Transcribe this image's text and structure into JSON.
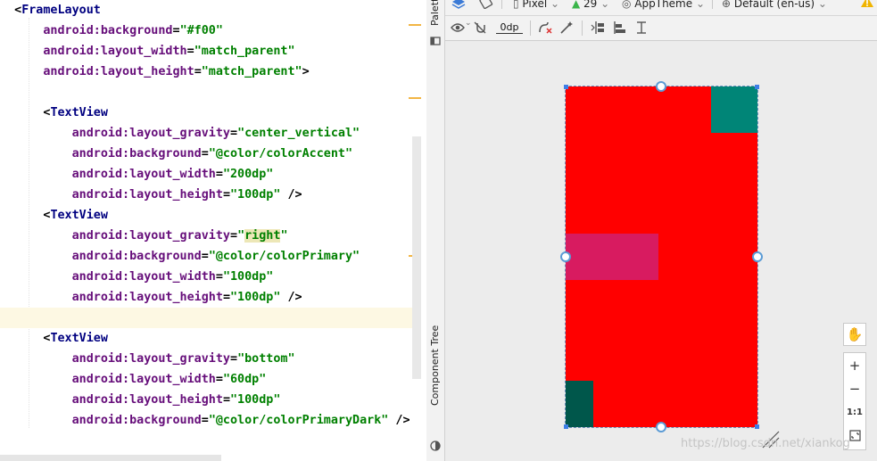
{
  "editor": {
    "lines": [
      {
        "parts": [
          {
            "c": "plain",
            "t": "  <"
          },
          {
            "c": "tag",
            "t": "FrameLayout"
          }
        ]
      },
      {
        "parts": [
          {
            "c": "plain",
            "t": "      "
          },
          {
            "c": "attr",
            "t": "android:background"
          },
          {
            "c": "plain",
            "t": "="
          },
          {
            "c": "val",
            "t": "\"#f00\""
          }
        ]
      },
      {
        "parts": [
          {
            "c": "plain",
            "t": "      "
          },
          {
            "c": "attr",
            "t": "android:layout_width"
          },
          {
            "c": "plain",
            "t": "="
          },
          {
            "c": "val",
            "t": "\"match_parent\""
          }
        ]
      },
      {
        "parts": [
          {
            "c": "plain",
            "t": "      "
          },
          {
            "c": "attr",
            "t": "android:layout_height"
          },
          {
            "c": "plain",
            "t": "="
          },
          {
            "c": "val",
            "t": "\"match_parent\""
          },
          {
            "c": "plain",
            "t": ">"
          }
        ]
      },
      {
        "parts": []
      },
      {
        "parts": [
          {
            "c": "plain",
            "t": "      <"
          },
          {
            "c": "tag",
            "t": "TextView"
          }
        ]
      },
      {
        "parts": [
          {
            "c": "plain",
            "t": "          "
          },
          {
            "c": "attr",
            "t": "android:layout_gravity"
          },
          {
            "c": "plain",
            "t": "="
          },
          {
            "c": "val",
            "t": "\"center_vertical\""
          }
        ]
      },
      {
        "parts": [
          {
            "c": "plain",
            "t": "          "
          },
          {
            "c": "attr",
            "t": "android:background"
          },
          {
            "c": "plain",
            "t": "="
          },
          {
            "c": "val",
            "t": "\"@color/colorAccent\""
          }
        ]
      },
      {
        "parts": [
          {
            "c": "plain",
            "t": "          "
          },
          {
            "c": "attr",
            "t": "android:layout_width"
          },
          {
            "c": "plain",
            "t": "="
          },
          {
            "c": "val",
            "t": "\"200dp\""
          }
        ]
      },
      {
        "parts": [
          {
            "c": "plain",
            "t": "          "
          },
          {
            "c": "attr",
            "t": "android:layout_height"
          },
          {
            "c": "plain",
            "t": "="
          },
          {
            "c": "val",
            "t": "\"100dp\""
          },
          {
            "c": "plain",
            "t": " />"
          }
        ]
      },
      {
        "parts": [
          {
            "c": "plain",
            "t": "      <"
          },
          {
            "c": "tag",
            "t": "TextView"
          }
        ]
      },
      {
        "parts": [
          {
            "c": "plain",
            "t": "          "
          },
          {
            "c": "attr",
            "t": "android:layout_gravity"
          },
          {
            "c": "plain",
            "t": "="
          },
          {
            "c": "val",
            "t": "\""
          },
          {
            "c": "valhl",
            "t": "right"
          },
          {
            "c": "val",
            "t": "\""
          }
        ]
      },
      {
        "parts": [
          {
            "c": "plain",
            "t": "          "
          },
          {
            "c": "attr",
            "t": "android:background"
          },
          {
            "c": "plain",
            "t": "="
          },
          {
            "c": "val",
            "t": "\"@color/colorPrimary\""
          }
        ]
      },
      {
        "parts": [
          {
            "c": "plain",
            "t": "          "
          },
          {
            "c": "attr",
            "t": "android:layout_width"
          },
          {
            "c": "plain",
            "t": "="
          },
          {
            "c": "val",
            "t": "\"100dp\""
          }
        ]
      },
      {
        "parts": [
          {
            "c": "plain",
            "t": "          "
          },
          {
            "c": "attr",
            "t": "android:layout_height"
          },
          {
            "c": "plain",
            "t": "="
          },
          {
            "c": "val",
            "t": "\"100dp\""
          },
          {
            "c": "plain",
            "t": " />"
          }
        ]
      },
      {
        "parts": [],
        "current": true
      },
      {
        "parts": [
          {
            "c": "plain",
            "t": "      <"
          },
          {
            "c": "tag",
            "t": "TextView"
          }
        ]
      },
      {
        "parts": [
          {
            "c": "plain",
            "t": "          "
          },
          {
            "c": "attr",
            "t": "android:layout_gravity"
          },
          {
            "c": "plain",
            "t": "="
          },
          {
            "c": "val",
            "t": "\"bottom\""
          }
        ]
      },
      {
        "parts": [
          {
            "c": "plain",
            "t": "          "
          },
          {
            "c": "attr",
            "t": "android:layout_width"
          },
          {
            "c": "plain",
            "t": "="
          },
          {
            "c": "val",
            "t": "\"60dp\""
          }
        ]
      },
      {
        "parts": [
          {
            "c": "plain",
            "t": "          "
          },
          {
            "c": "attr",
            "t": "android:layout_height"
          },
          {
            "c": "plain",
            "t": "="
          },
          {
            "c": "val",
            "t": "\"100dp\""
          }
        ]
      },
      {
        "parts": [
          {
            "c": "plain",
            "t": "          "
          },
          {
            "c": "attr",
            "t": "android:background"
          },
          {
            "c": "plain",
            "t": "="
          },
          {
            "c": "val",
            "t": "\"@color/colorPrimaryDark\""
          },
          {
            "c": "plain",
            "t": " />"
          }
        ]
      }
    ]
  },
  "side_panel": {
    "palette_label": "Palette",
    "component_tree_label": "Component Tree"
  },
  "toolbar_top": {
    "device": "Pixel",
    "api_level": "29",
    "theme": "AppTheme",
    "locale": "Default (en-us)"
  },
  "toolbar_design": {
    "default_margin": "0dp"
  },
  "canvas": {
    "colors": {
      "frame_background": "#ff0000",
      "color_accent": "#d81b60",
      "color_primary": "#008577",
      "color_primary_dark": "#00574b"
    }
  },
  "zoom_panel": {
    "zoom_in": "+",
    "zoom_out": "−",
    "actual_size": "1:1"
  },
  "watermark": "https://blog.csdn.net/xiankog"
}
